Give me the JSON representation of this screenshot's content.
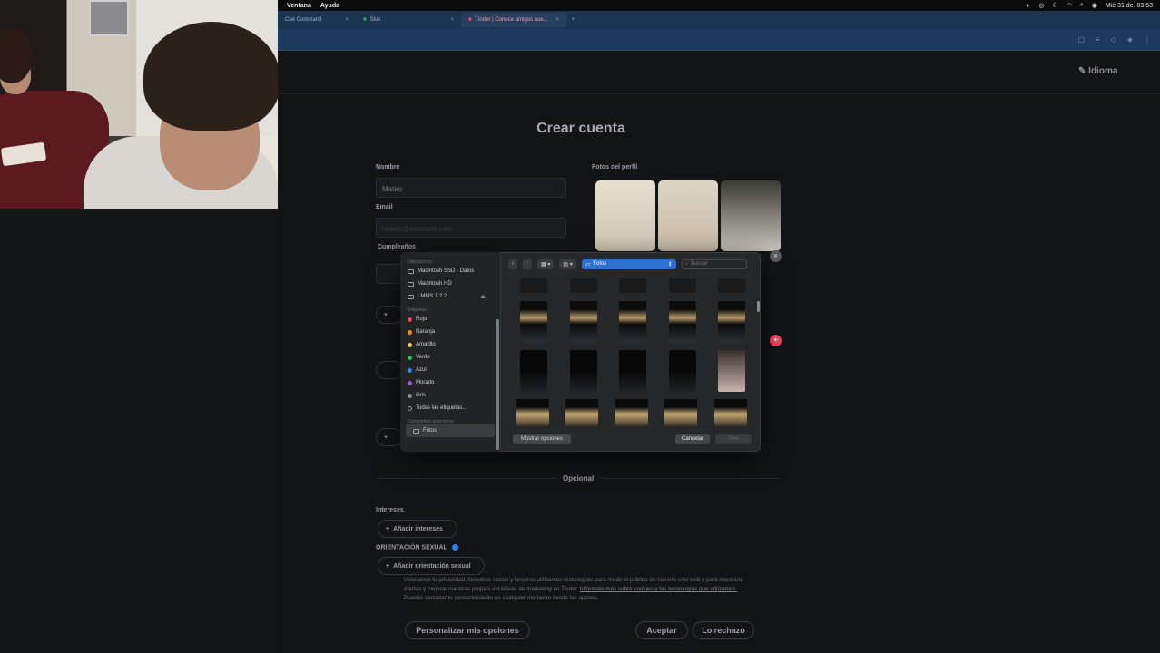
{
  "menubar": {
    "items": [
      "Ventana",
      "Ayuda"
    ],
    "datetime": "Mié 31 de. 03:53"
  },
  "browser": {
    "tabs": [
      {
        "label": "Cue Command"
      },
      {
        "label": "Skio"
      },
      {
        "label": "Tinder | Conoce amigos nue..."
      }
    ]
  },
  "page": {
    "language": "Idioma",
    "title": "Crear cuenta",
    "name_label": "Nombre",
    "name_value": "Mateo",
    "email_label": "Email",
    "email_value": "mateo@example.com",
    "birthday_label": "Cumpleaños",
    "photos_label": "Fotos del perfil",
    "optional": "Opcional",
    "interests_label": "Intereses",
    "add_interests": "Añadir intereses",
    "orientation_label": "ORIENTACIÓN SEXUAL",
    "add_orientation": "Añadir orientación sexual"
  },
  "dialog": {
    "sections": {
      "locations": "Ubicaciones",
      "tags": "Etiquetas",
      "shared": "Compartido anteriorme"
    },
    "locations": [
      "Macintosh SSD - Datos",
      "Macintosh HD",
      "LMMS 1.2.2"
    ],
    "tags": [
      {
        "label": "Rojo",
        "color": "#e5484d"
      },
      {
        "label": "Naranja",
        "color": "#f08a24"
      },
      {
        "label": "Amarillo",
        "color": "#f2c94c"
      },
      {
        "label": "Verde",
        "color": "#2fbf5a"
      },
      {
        "label": "Azul",
        "color": "#2f80ed"
      },
      {
        "label": "Morado",
        "color": "#a259d9"
      },
      {
        "label": "Gris",
        "color": "#8e8e93"
      }
    ],
    "all_tags": "Todas las etiquetas...",
    "shared_folder": "Fotos",
    "current_folder": "Fotos",
    "search_placeholder": "Buscar",
    "options_button": "Mostrar opciones",
    "cancel_button": "Cancelar",
    "open_button": "Abrir"
  },
  "cookie": {
    "text": "Valoramos tu privacidad. Nosotros socios y terceros utilizamos tecnologías para medir el público de nuestro sitio web y para mostrarte ofertas y mejorar nuestras propias iniciativas de marketing en Tinder. ",
    "link": "Infórmate más sobre cookies y las tecnologías que utilizamos.",
    "text2": " Puedes cancelar tu consentimiento en cualquier momento desde las ajustes.",
    "customize": "Personalizar mis opciones",
    "accept": "Aceptar",
    "reject": "Lo rechazo"
  }
}
